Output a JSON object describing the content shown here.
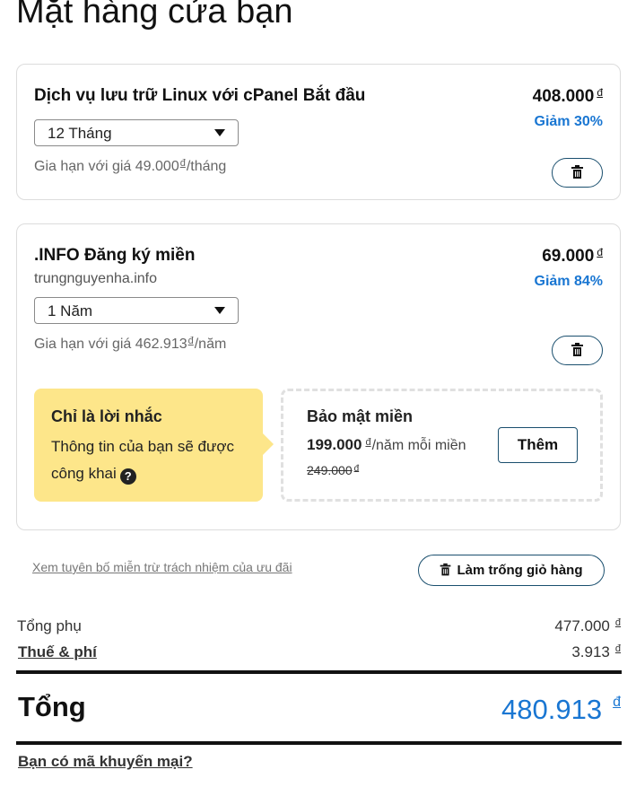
{
  "page": {
    "title": "Mặt hàng cửa bạn"
  },
  "items": [
    {
      "name": "Dịch vụ lưu trữ Linux với cPanel Bắt đầu",
      "price": "408.000",
      "currency": "đ",
      "discount": "Giảm 30%",
      "term": "12 Tháng",
      "renew_prefix": "Gia hạn với giá 49.000",
      "renew_suffix": "/tháng"
    },
    {
      "name": ".INFO Đăng ký miền",
      "domain": "trungnguyenha.info",
      "price": "69.000",
      "currency": "đ",
      "discount": "Giảm 84%",
      "term": "1 Năm",
      "renew_prefix": "Gia hạn với giá 462.913",
      "renew_suffix": "/năm"
    }
  ],
  "reminder": {
    "title": "Chỉ là lời nhắc",
    "text": "Thông tin của bạn sẽ được công khai",
    "help_glyph": "?"
  },
  "upsell": {
    "title": "Bảo mật miền",
    "price": "199.000",
    "currency": "đ",
    "unit": "/năm mỗi miền",
    "old_price": "249.000",
    "add_label": "Thêm"
  },
  "actions": {
    "disclaimer": "Xem tuyên bố miễn trừ trách nhiệm của ưu đãi",
    "empty_cart": "Làm trống giỏ hàng"
  },
  "summary": {
    "subtotal_label": "Tổng phụ",
    "subtotal": "477.000",
    "tax_label": "Thuế & phí",
    "tax": "3.913",
    "total_label": "Tổng",
    "total": "480.913",
    "currency": "đ",
    "promo_label": "Bạn có mã khuyến mại?"
  },
  "colors": {
    "accent": "#1976d2",
    "reminder_bg": "#fde68a",
    "button_border": "#1a4f6e"
  },
  "icons": {
    "delete": "trash-icon",
    "dropdown": "chevron-down-icon",
    "help": "help-icon"
  }
}
